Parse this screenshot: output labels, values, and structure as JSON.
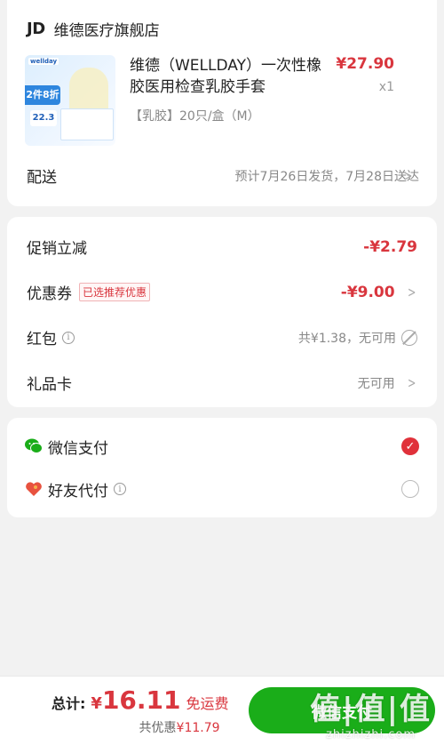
{
  "shop": {
    "logo": "JD",
    "name": "维德医疗旗舰店"
  },
  "product": {
    "image_brand": "wellday",
    "image_promo": "2件8折",
    "image_price": "22.3",
    "title": "维德（WELLDAY）一次性橡胶医用检查乳胶手套",
    "spec": "【乳胶】20只/盒（M）",
    "price": "¥27.90",
    "qty": "x1"
  },
  "delivery": {
    "label": "配送",
    "info": "预计7月26日发货，7月28日送达"
  },
  "discounts": {
    "promo": {
      "label": "促销立减",
      "amount": "-¥2.79"
    },
    "coupon": {
      "label": "优惠券",
      "badge": "已选推荐优惠",
      "amount": "-¥9.00"
    },
    "redpacket": {
      "label": "红包",
      "info": "共¥1.38，无可用"
    },
    "giftcard": {
      "label": "礼品卡",
      "info": "无可用"
    }
  },
  "payment": {
    "wechat": {
      "label": "微信支付",
      "selected": true
    },
    "friend": {
      "label": "好友代付",
      "selected": false
    }
  },
  "footer": {
    "total_label": "总计:",
    "currency": "¥",
    "total": "16.11",
    "free_shipping": "免运费",
    "discount_label": "共优惠",
    "discount_amount": "¥11.79",
    "pay_button": "微信支付"
  },
  "watermark": {
    "big": "值|值|值",
    "small": "zhizhizhi.com"
  },
  "colors": {
    "accent_red": "#d9363e",
    "wechat_green": "#1aad19",
    "radio_red": "#e0313a"
  }
}
